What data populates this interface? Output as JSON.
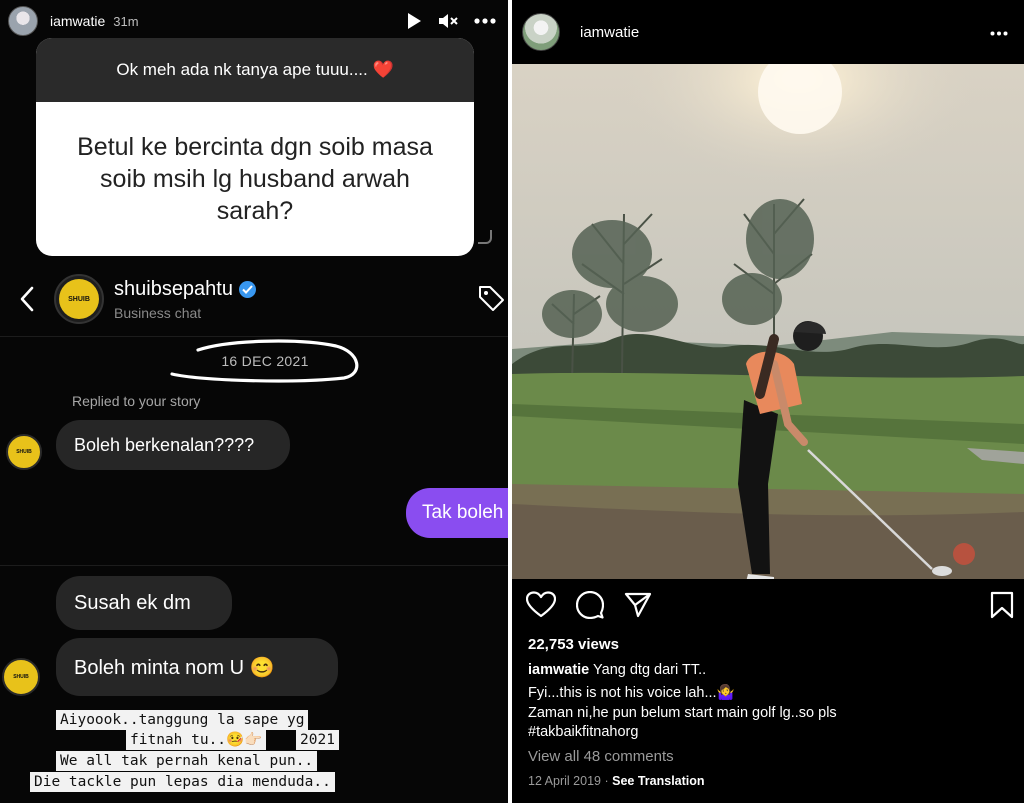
{
  "story": {
    "username": "iamwatie",
    "time": "31m",
    "question_header": "Ok meh ada nk tanya ape tuuu.... ❤️",
    "question_body": "Betul ke bercinta dgn soib masa soib msih lg husband arwah sarah?"
  },
  "chat": {
    "business_name": "shuibsepahtu",
    "business_sub": "Business chat",
    "date": "16 DEC 2021",
    "replied_label": "Replied to your story",
    "messages": [
      {
        "from": "them",
        "text": "Boleh berkenalan????"
      },
      {
        "from": "me",
        "text": "Tak boleh"
      },
      {
        "from": "them",
        "text": "Susah ek dm"
      },
      {
        "from": "them",
        "text": "Boleh minta nom U 😊"
      }
    ],
    "caption_lines": [
      "Aiyoook..tanggung la sape yg",
      "fitnah tu..🤒👉🏻",
      "2021",
      "We all tak pernah kenal pun..",
      "Die tackle pun lepas dia menduda.."
    ]
  },
  "post": {
    "username": "iamwatie",
    "views": "22,753 views",
    "caption_user": "iamwatie",
    "caption_lines": [
      "Yang dtg dari TT..",
      "Fyi...this is not his voice lah...🤷‍♀️",
      "Zaman ni,he pun belum start main golf lg..so pls",
      "#takbaikfitnahorg"
    ],
    "view_comments": "View all 48 comments",
    "date": "12 April 2019",
    "date_sep": "·",
    "see_translation": "See Translation"
  },
  "colors": {
    "outgoing_bubble": "#8a4df0",
    "incoming_bubble": "#262626",
    "verified": "#3897f0",
    "background": "#000000"
  }
}
